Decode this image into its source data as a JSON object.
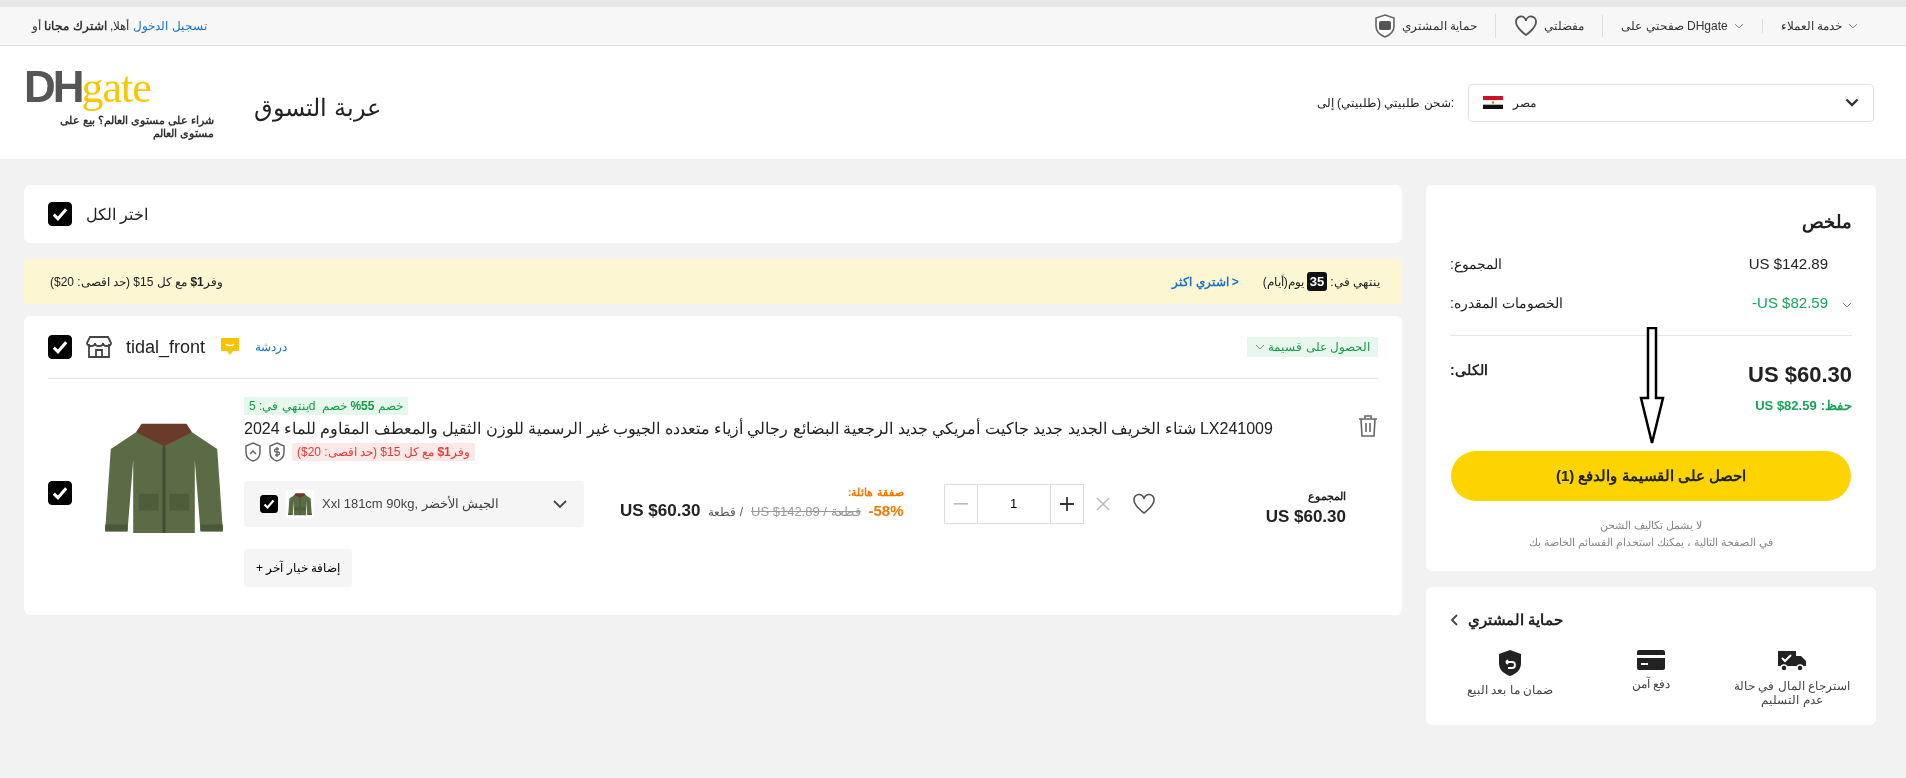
{
  "top_bar": {
    "greeting": "أهلا, **اشترك مجانا** أو",
    "login_link": "تسجيل الدخول",
    "links": [
      {
        "kind": "caret",
        "label": "خدمة العملاء"
      },
      {
        "kind": "caret",
        "label": "DHgate صفحتي على"
      },
      {
        "kind": "heart",
        "label": "مفضلتي"
      },
      {
        "kind": "shield",
        "label": "حماية المشتري"
      }
    ]
  },
  "header": {
    "logo_dark": "DH",
    "logo_light": "gate",
    "tagline": "شراء على مستوى العالم؟ بيع على مستوى العالم",
    "title": "عربة التسوق",
    "ship_label": ":شحن طلبيتي (طلبيتي) إلى",
    "country": "مصر"
  },
  "select_all": {
    "label": "اختر الكل",
    "checked": true
  },
  "banner": {
    "offer": "وفر**1$** مع كل 15$ (حد اقصى: 20$)",
    "buy_more": "< اشتري اكثر",
    "ends_label": "ينتهي في:",
    "days": "35",
    "days_unit": "يوم(أيام)"
  },
  "store": {
    "checked": true,
    "name": "tidal_front",
    "chat": "دردشة",
    "coupon": "الحصول على قسيمة",
    "item": {
      "checked": true,
      "countdown": "dينتهي في: 5",
      "discount_tag": "خصم **55%** خصم",
      "title": "LX241009 شتاء الخريف الجديد جديد جاكيت أمريكي جديد الرجعية البضائع رجالي أزياء متعدده الجيوب غير الرسمية للوزن الثقيل والمعطف المقاوم للماء 2024",
      "promo": "وفر**1$** مع كل 15$ (حد اقصى: 20$)",
      "variant": {
        "checked": true,
        "label": "Xxl 181cm 90kg, الجيش الأخضر"
      },
      "deal_label": "صفقة هائلة:",
      "price": "US $60.30",
      "unit": "/ قطعة",
      "old_price": "US $142.89 / قطعة",
      "discount": "-58%",
      "quantity": "1",
      "subtotal_label": "المجموع",
      "subtotal": "US $60.30",
      "add_option": "إضافة خيار آخر +"
    }
  },
  "summary": {
    "title": "ملخص",
    "rows": [
      {
        "kind": "plain",
        "label": "المجموع:",
        "value": "US $142.89"
      },
      {
        "kind": "discount",
        "label": "الخصومات المقدره:",
        "value": "-US $82.59"
      }
    ],
    "total_label": "الكلى:",
    "total": "US $60.30",
    "saved_label": "حفظ:",
    "saved": "US $82.59",
    "checkout": "احصل على القسيمة والدفع (1)",
    "notes": [
      "لا يشمل تكاليف الشحن",
      "في الصفحة التالية ، يمكنك استخدام القسائم الخاصة بك"
    ]
  },
  "protection": {
    "title": "حماية المشتري",
    "items": [
      {
        "kind": "truck",
        "label": "استرجاع المال في حالة عدم التسليم"
      },
      {
        "kind": "card",
        "label": "دفع آمن"
      },
      {
        "kind": "shield",
        "label": "ضمان ما بعد البيع"
      }
    ]
  }
}
